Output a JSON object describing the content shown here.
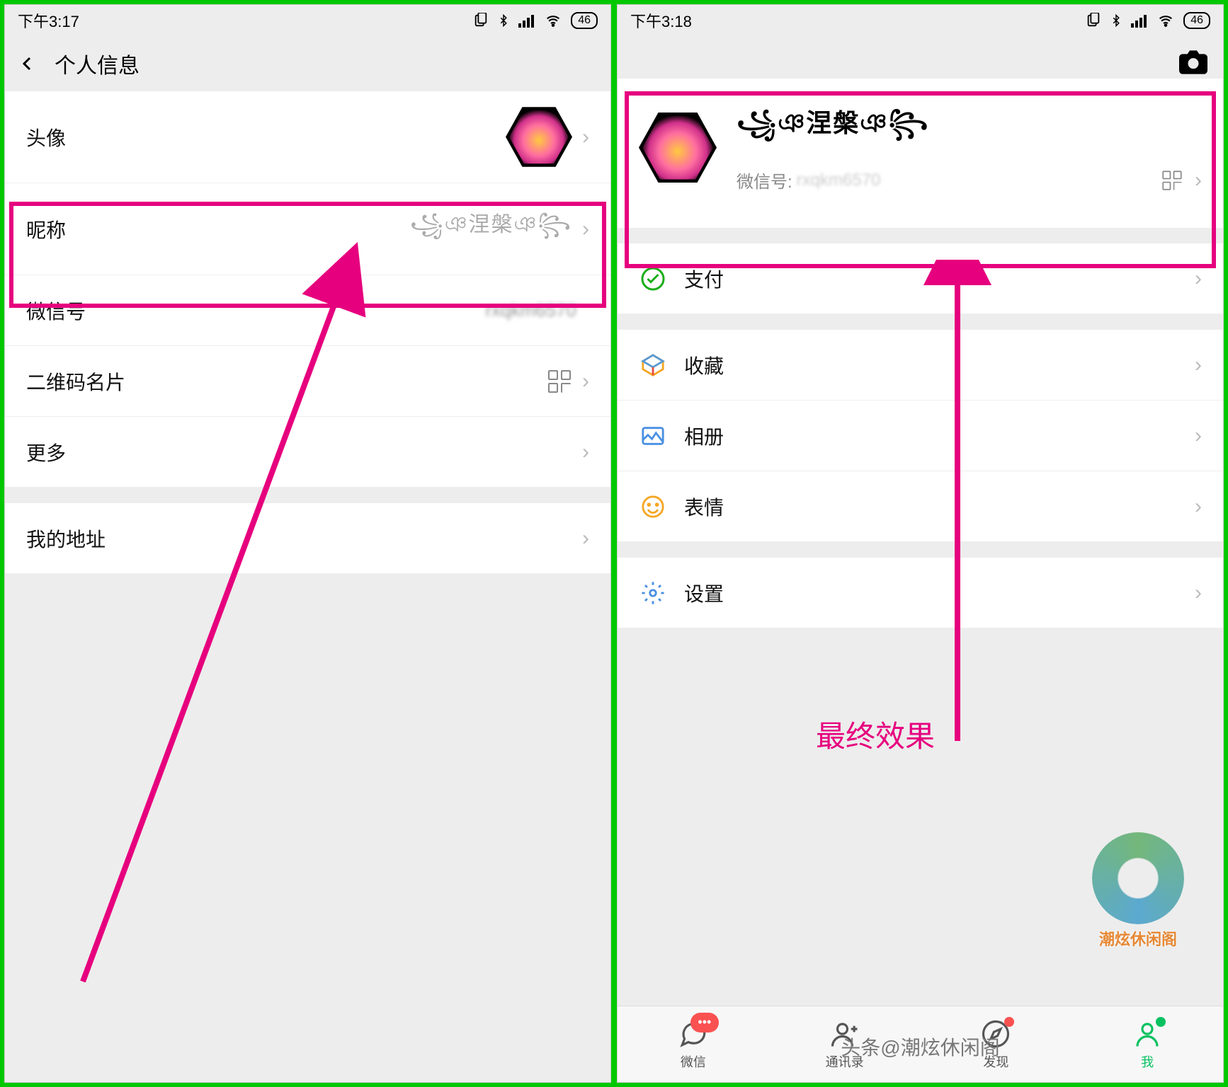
{
  "status": {
    "time_left": "下午3:17",
    "time_right": "下午3:18",
    "battery": "46"
  },
  "left": {
    "title": "个人信息",
    "rows": {
      "avatar": "头像",
      "nickname": "昵称",
      "nickname_value": "꧁ঞ涅槃ঞ꧂",
      "wechat_id": "微信号",
      "wechat_id_value": "rxqkm6570",
      "qrcode": "二维码名片",
      "more": "更多",
      "address": "我的地址"
    }
  },
  "right": {
    "profile": {
      "nickname": "꧁ঞ涅槃ঞ꧂",
      "wechat_label": "微信号:",
      "wechat_id": "rxqkm6570"
    },
    "menu": {
      "pay": "支付",
      "favorites": "收藏",
      "album": "相册",
      "stickers": "表情",
      "settings": "设置"
    },
    "tabs": {
      "chats": "微信",
      "contacts": "通讯录",
      "discover": "发现",
      "me": "我",
      "badge": "•••"
    },
    "annot": "最终效果",
    "watermark": "潮炫休闲阁",
    "credit": "头条@潮炫休闲阁"
  }
}
